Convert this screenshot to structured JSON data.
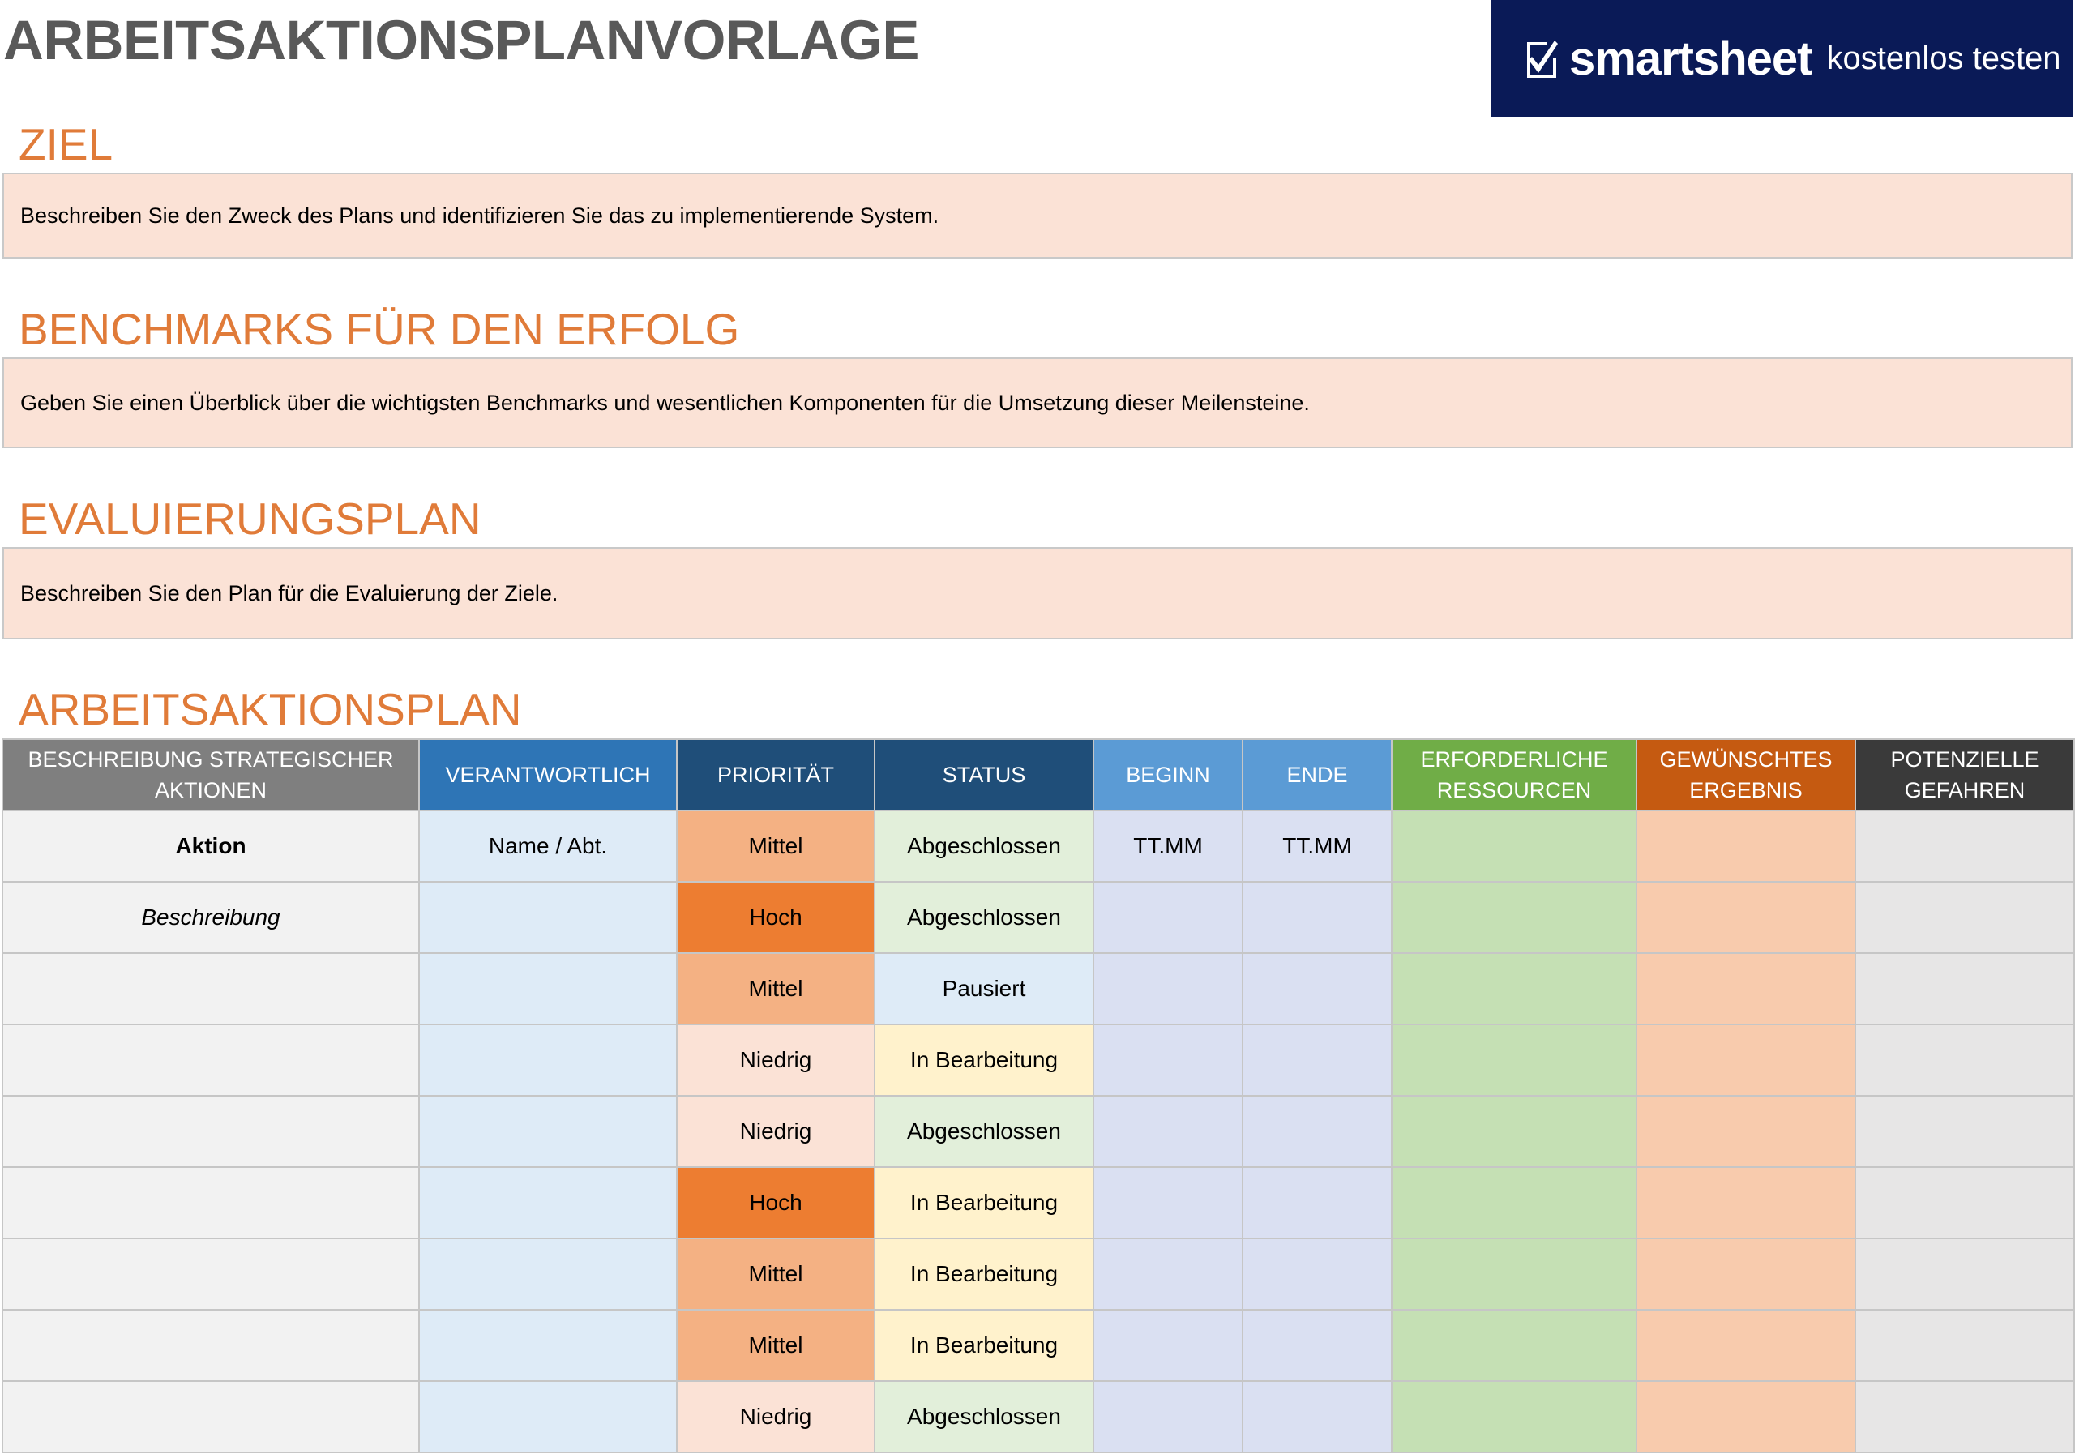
{
  "title": "ARBEITSAKTIONSPLANVORLAGE",
  "brand": {
    "name": "smartsheet",
    "cta": "kostenlos testen",
    "logo_icon": "checkmark-icon"
  },
  "sections": {
    "goal": {
      "heading": "ZIEL",
      "text": "Beschreiben Sie den Zweck des Plans und identifizieren Sie das zu implementierende System."
    },
    "benchmarks": {
      "heading": "BENCHMARKS FÜR DEN ERFOLG",
      "text": "Geben Sie einen Überblick über die wichtigsten Benchmarks und wesentlichen Komponenten für die Umsetzung dieser Meilensteine."
    },
    "evaluation": {
      "heading": "EVALUIERUNGSPLAN",
      "text": "Beschreiben Sie den Plan für die Evaluierung der Ziele."
    },
    "plan": {
      "heading": "ARBEITSAKTIONSPLAN"
    }
  },
  "table": {
    "headers": {
      "description": "BESCHREIBUNG STRATEGISCHER AKTIONEN",
      "responsible": "VERANTWORTLICH",
      "priority": "PRIORITÄT",
      "status": "STATUS",
      "start": "BEGINN",
      "end": "ENDE",
      "resources": "ERFORDERLICHE RESSOURCEN",
      "outcome": "GEWÜNSCHTES ERGEBNIS",
      "risks": "POTENZIELLE GEFAHREN"
    },
    "rows": [
      {
        "description": "Aktion",
        "responsible": "Name / Abt.",
        "priority": "Mittel",
        "status": "Abgeschlossen",
        "start": "TT.MM",
        "end": "TT.MM",
        "resources": "",
        "outcome": "",
        "risks": ""
      },
      {
        "description": "Beschreibung",
        "responsible": "",
        "priority": "Hoch",
        "status": "Abgeschlossen",
        "start": "",
        "end": "",
        "resources": "",
        "outcome": "",
        "risks": ""
      },
      {
        "description": "",
        "responsible": "",
        "priority": "Mittel",
        "status": "Pausiert",
        "start": "",
        "end": "",
        "resources": "",
        "outcome": "",
        "risks": ""
      },
      {
        "description": "",
        "responsible": "",
        "priority": "Niedrig",
        "status": "In Bearbeitung",
        "start": "",
        "end": "",
        "resources": "",
        "outcome": "",
        "risks": ""
      },
      {
        "description": "",
        "responsible": "",
        "priority": "Niedrig",
        "status": "Abgeschlossen",
        "start": "",
        "end": "",
        "resources": "",
        "outcome": "",
        "risks": ""
      },
      {
        "description": "",
        "responsible": "",
        "priority": "Hoch",
        "status": "In Bearbeitung",
        "start": "",
        "end": "",
        "resources": "",
        "outcome": "",
        "risks": ""
      },
      {
        "description": "",
        "responsible": "",
        "priority": "Mittel",
        "status": "In Bearbeitung",
        "start": "",
        "end": "",
        "resources": "",
        "outcome": "",
        "risks": ""
      },
      {
        "description": "",
        "responsible": "",
        "priority": "Mittel",
        "status": "In Bearbeitung",
        "start": "",
        "end": "",
        "resources": "",
        "outcome": "",
        "risks": ""
      },
      {
        "description": "",
        "responsible": "",
        "priority": "Niedrig",
        "status": "Abgeschlossen",
        "start": "",
        "end": "",
        "resources": "",
        "outcome": "",
        "risks": ""
      }
    ]
  },
  "colors": {
    "priority": {
      "Hoch": "#ed7d31",
      "Mittel": "#f4b183",
      "Niedrig": "#fbe2d6"
    },
    "status": {
      "Abgeschlossen": "#e2efda",
      "Pausiert": "#deebf7",
      "In Bearbeitung": "#fff2cc"
    }
  }
}
